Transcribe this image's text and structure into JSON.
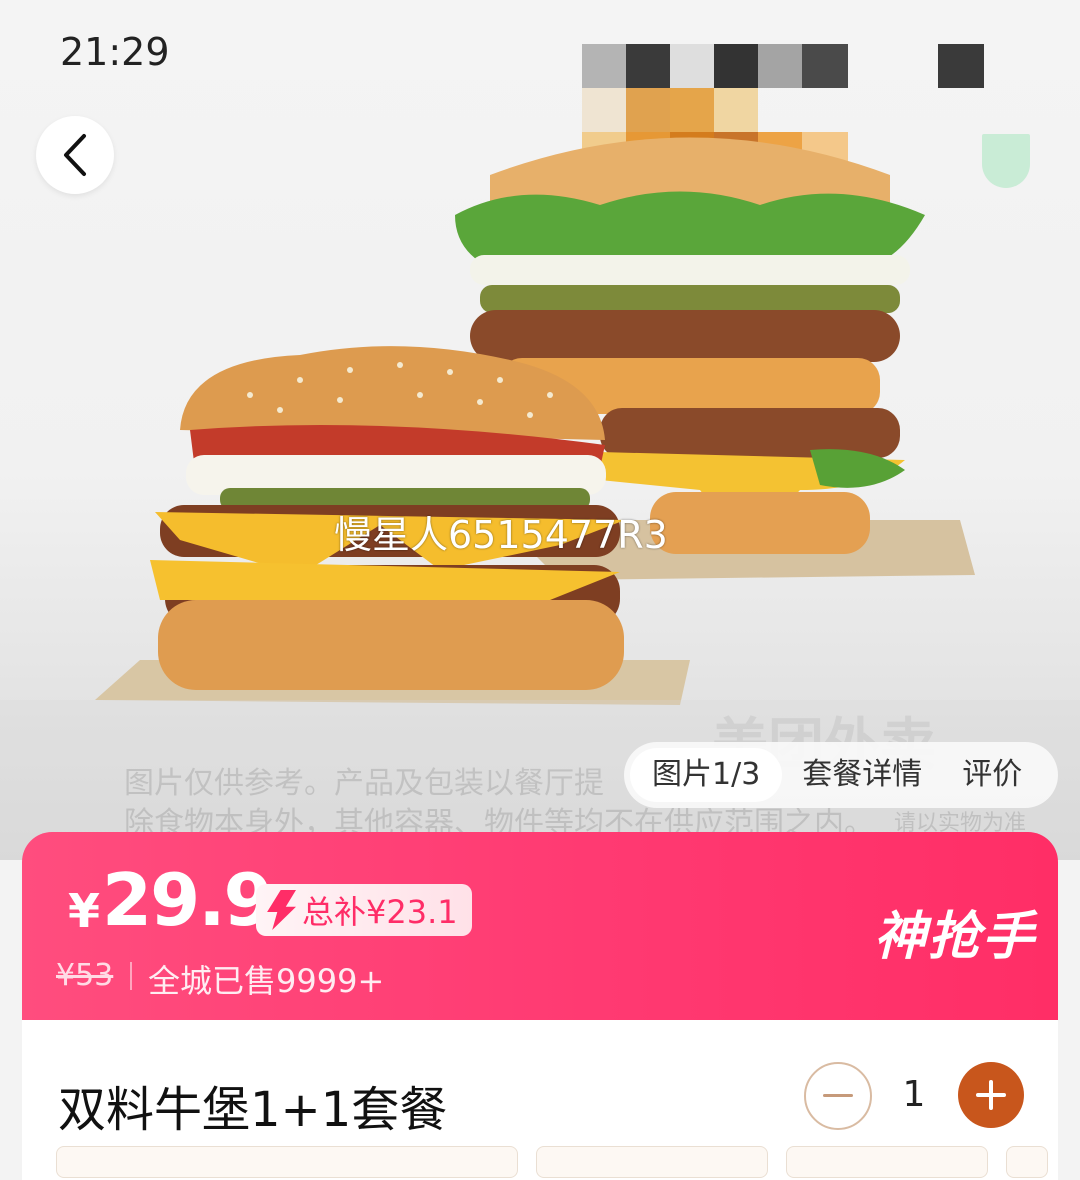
{
  "status_bar": {
    "time": "21:29"
  },
  "watermark": "慢星人6515477R3",
  "brand_mark": "美团外卖",
  "disclaimer": {
    "line1": "图片仅供参考。产品及包装以餐厅提",
    "line2": "除食物本身外，其他容器、物件等均不在供应范围之内。",
    "note": "请以实物为准"
  },
  "media_tabs": [
    "图片1/3",
    "套餐详情",
    "评价"
  ],
  "price": {
    "currency": "¥",
    "amount": "29.9",
    "subsidy": "总补¥23.1",
    "original": "¥53",
    "sold": "全城已售9999+",
    "badge": "神抢手"
  },
  "product": {
    "name": "双料牛堡1+1套餐",
    "quantity": "1"
  },
  "icons": {
    "back": "chevron-left-icon",
    "minus": "minus-icon",
    "plus": "plus-icon",
    "subsidy": "lightning-icon"
  },
  "colors": {
    "accent": "#ff3a72",
    "button": "#c8561c"
  }
}
